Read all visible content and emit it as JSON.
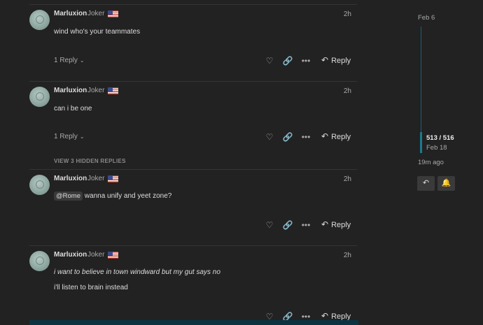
{
  "posts": [
    {
      "author": "Marluxion",
      "title": "Joker",
      "time": "2h",
      "lines": [
        "wind who's your teammates"
      ],
      "replies_label": "1 Reply",
      "reply_label": "Reply"
    },
    {
      "author": "Marluxion",
      "title": "Joker",
      "time": "2h",
      "lines": [
        "can i be one"
      ],
      "replies_label": "1 Reply",
      "reply_label": "Reply"
    },
    {
      "author": "Marluxion",
      "title": "Joker",
      "time": "2h",
      "mention": "@Rome",
      "lines": [
        "wanna unify and yeet zone?"
      ],
      "reply_label": "Reply"
    },
    {
      "author": "Marluxion",
      "title": "Joker",
      "time": "2h",
      "lines": [
        "i want to believe in town windward but my gut says no",
        "i'll listen to brain instead"
      ],
      "reply_label": "Reply"
    }
  ],
  "hidden_replies_label": "VIEW 3 HIDDEN REPLIES",
  "timeline": {
    "start_date": "Feb 6",
    "position": "513 / 516",
    "current_date": "Feb 18",
    "last_activity": "19m ago"
  },
  "icons": {
    "like": "heart-icon",
    "link": "link-icon",
    "more": "ellipsis-icon",
    "reply": "reply-arrow-icon",
    "bell": "bell-icon"
  },
  "colors": {
    "background": "#222222",
    "timeline_accent": "#1b7a8b",
    "bell": "#2e9fe6"
  }
}
